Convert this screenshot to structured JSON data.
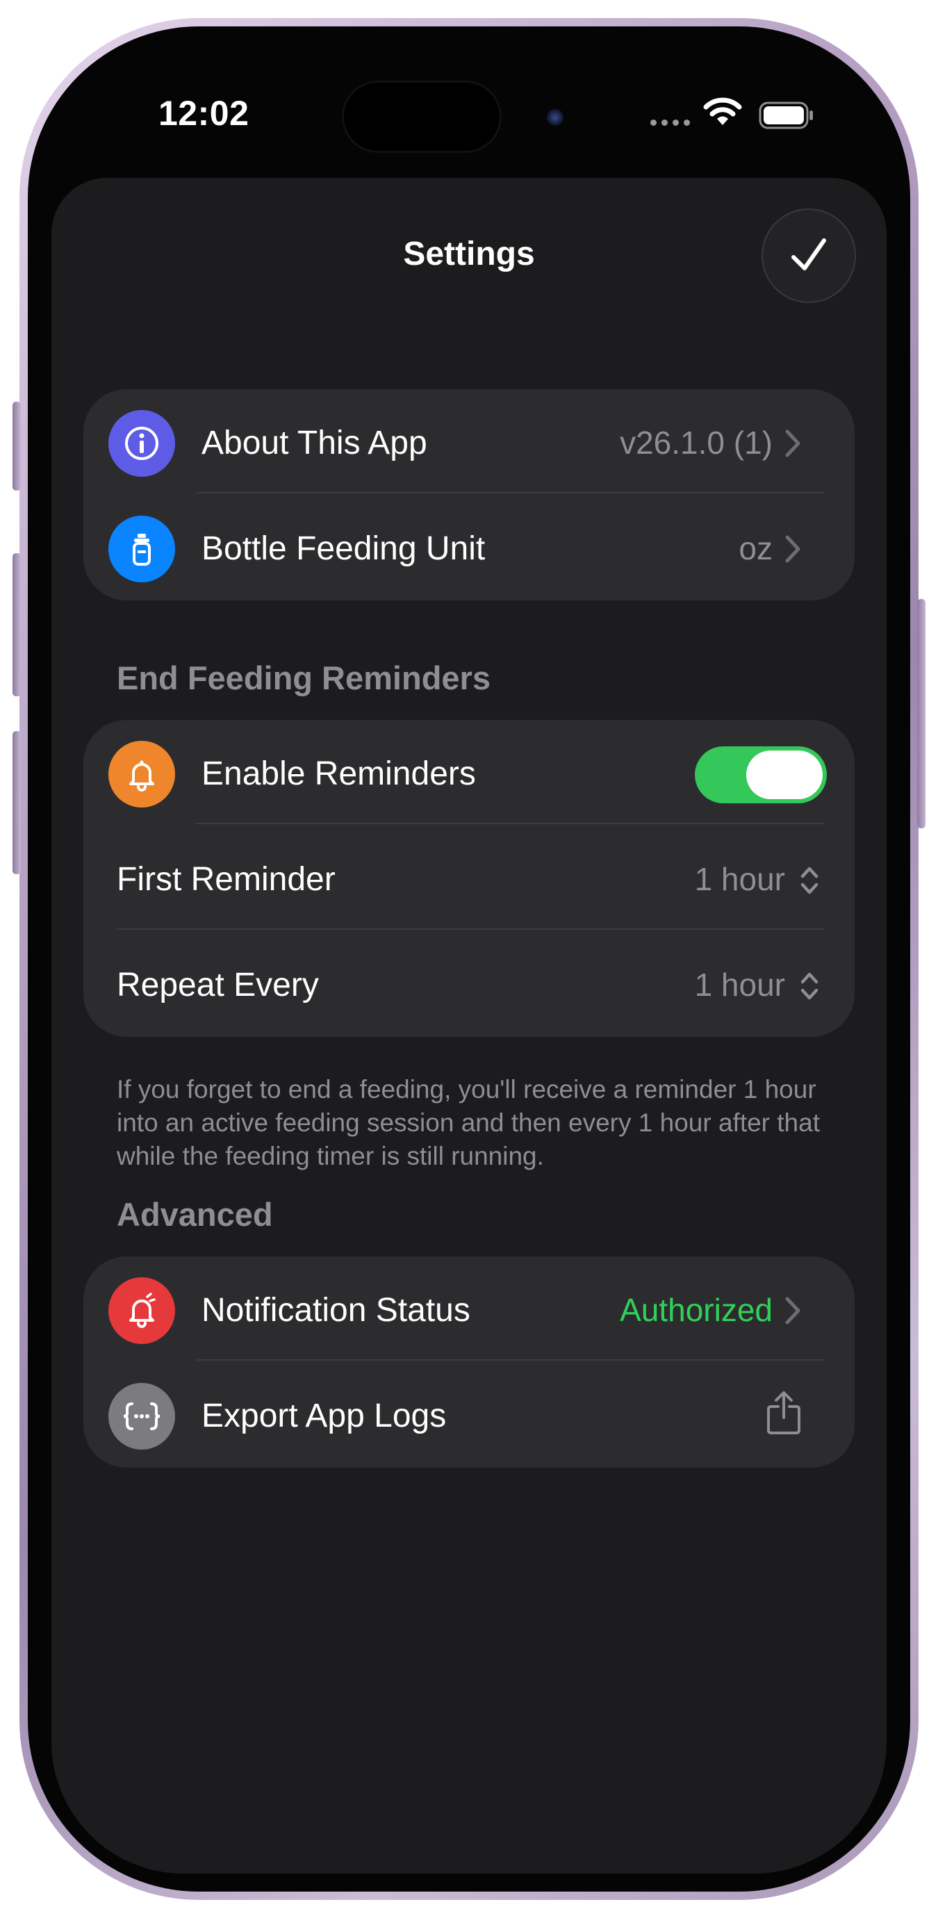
{
  "status_bar": {
    "time": "12:02"
  },
  "sheet": {
    "title": "Settings"
  },
  "general": {
    "rows": [
      {
        "label": "About This App",
        "value": "v26.1.0 (1)",
        "icon": "info-icon",
        "icon_color": "#5e5ce6"
      },
      {
        "label": "Bottle Feeding Unit",
        "value": "oz",
        "icon": "bottle-icon",
        "icon_color": "#0a84ff"
      }
    ]
  },
  "reminders": {
    "header": "End Feeding Reminders",
    "enable": {
      "label": "Enable Reminders",
      "on": true,
      "icon": "bell-icon",
      "icon_color": "#f0862b",
      "toggle_color": "#34c759"
    },
    "first": {
      "label": "First Reminder",
      "value": "1 hour"
    },
    "repeat": {
      "label": "Repeat Every",
      "value": "1 hour"
    },
    "footer": "If you forget to end a feeding, you'll receive a reminder 1 hour into an active feeding session and then every 1 hour after that while the feeding timer is still running."
  },
  "advanced": {
    "header": "Advanced",
    "rows": [
      {
        "label": "Notification Status",
        "value": "Authorized",
        "value_color": "#30d158",
        "icon": "bell-badge-icon",
        "icon_color": "#e5393b"
      },
      {
        "label": "Export App Logs",
        "icon": "curly-braces-icon",
        "icon_color": "#7c7c80",
        "action_icon": "share-icon"
      }
    ]
  }
}
